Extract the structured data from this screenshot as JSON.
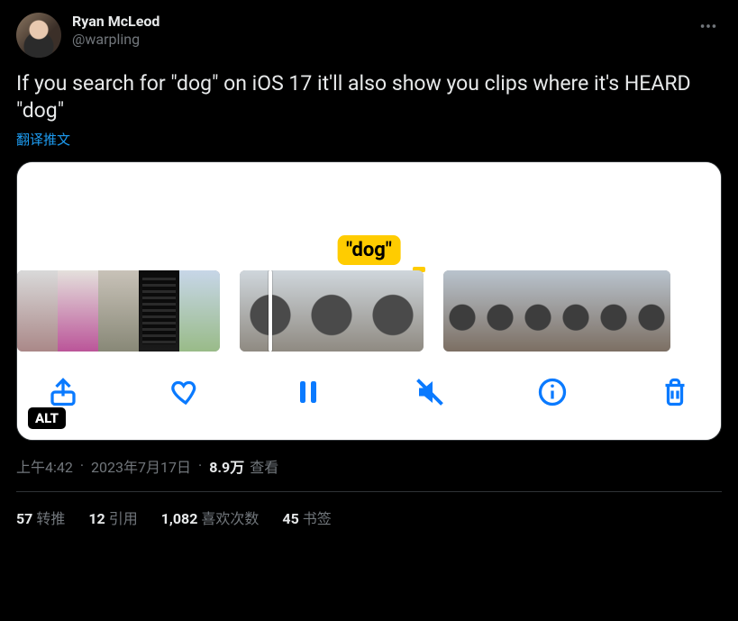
{
  "author": {
    "display_name": "Ryan McLeod",
    "handle": "@warpling"
  },
  "body": "If you search for \"dog\" on iOS 17 it'll also show you clips where it's HEARD \"dog\"",
  "translate_label": "翻译推文",
  "media": {
    "search_term_label": "\"dog\"",
    "alt_badge": "ALT",
    "toolbar": {
      "share": "share",
      "like": "like",
      "pause": "pause",
      "mute": "mute",
      "info": "info",
      "delete": "delete"
    }
  },
  "meta": {
    "time": "上午4:42",
    "date": "2023年7月17日",
    "views_count": "8.9万",
    "views_label": "查看"
  },
  "stats": {
    "retweets_count": "57",
    "retweets_label": "转推",
    "quotes_count": "12",
    "quotes_label": "引用",
    "likes_count": "1,082",
    "likes_label": "喜欢次数",
    "bookmarks_count": "45",
    "bookmarks_label": "书签"
  }
}
